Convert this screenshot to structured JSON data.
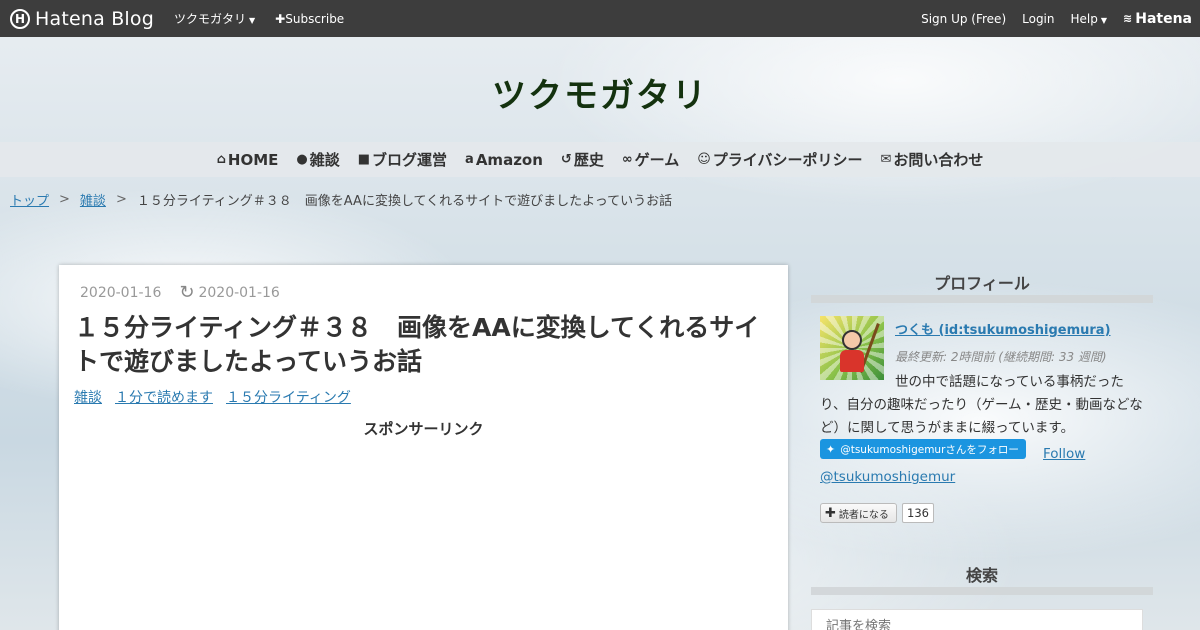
{
  "topbar": {
    "logo_mark": "H",
    "logo_text": "Hatena Blog",
    "blog_menu": "ツクモガタリ",
    "subscribe": "Subscribe",
    "signup": "Sign Up (Free)",
    "login": "Login",
    "help": "Help",
    "hatena": "Hatena"
  },
  "header": {
    "title": "ツクモガタリ"
  },
  "nav": [
    {
      "icon": "home-icon",
      "label": "HOME"
    },
    {
      "icon": "chat-icon",
      "label": "雑談"
    },
    {
      "icon": "blogger-icon",
      "label": "ブログ運営"
    },
    {
      "icon": "amazon-icon",
      "label": "Amazon"
    },
    {
      "icon": "history-icon",
      "label": "歴史"
    },
    {
      "icon": "gamepad-icon",
      "label": "ゲーム"
    },
    {
      "icon": "smile-icon",
      "label": "プライバシーポリシー"
    },
    {
      "icon": "envelope-icon",
      "label": "お問い合わせ"
    }
  ],
  "breadcrumb": {
    "top": "トップ",
    "separator": ">",
    "category": "雑談",
    "current": "１５分ライティング＃３８　画像をAAに変換してくれるサイトで遊びましたよっていうお話"
  },
  "article": {
    "date": "2020-01-16",
    "updated": "2020-01-16",
    "title": "１５分ライティング＃３８　画像をAAに変換してくれるサイトで遊びましたよっていうお話",
    "categories": [
      "雑談",
      "１分で読めます",
      "１５分ライティング"
    ],
    "sponsor": "スポンサーリンク"
  },
  "sidebar": {
    "profile_heading": "プロフィール",
    "name": "つくも (id:tsukumoshigemura)",
    "last_updated": "最終更新: 2時間前 (継続期間: 33 週間)",
    "description": "世の中で話題になっている事柄だったり、自分の趣味だったり（ゲーム・歴史・動画などなど）に関して思うがままに綴っています。",
    "twitter_button": "@tsukumoshigemurさんをフォロー",
    "follow": "Follow",
    "follow_handle": "@tsukumoshigemur",
    "reader_button": "読者になる",
    "reader_count": "136",
    "search_heading": "検索",
    "search_placeholder": "記事を検索"
  },
  "colors": {
    "topbar_bg": "#3d3d3d",
    "title": "#14320f",
    "link": "#2a7ab0",
    "twitter": "#1b95e0"
  }
}
